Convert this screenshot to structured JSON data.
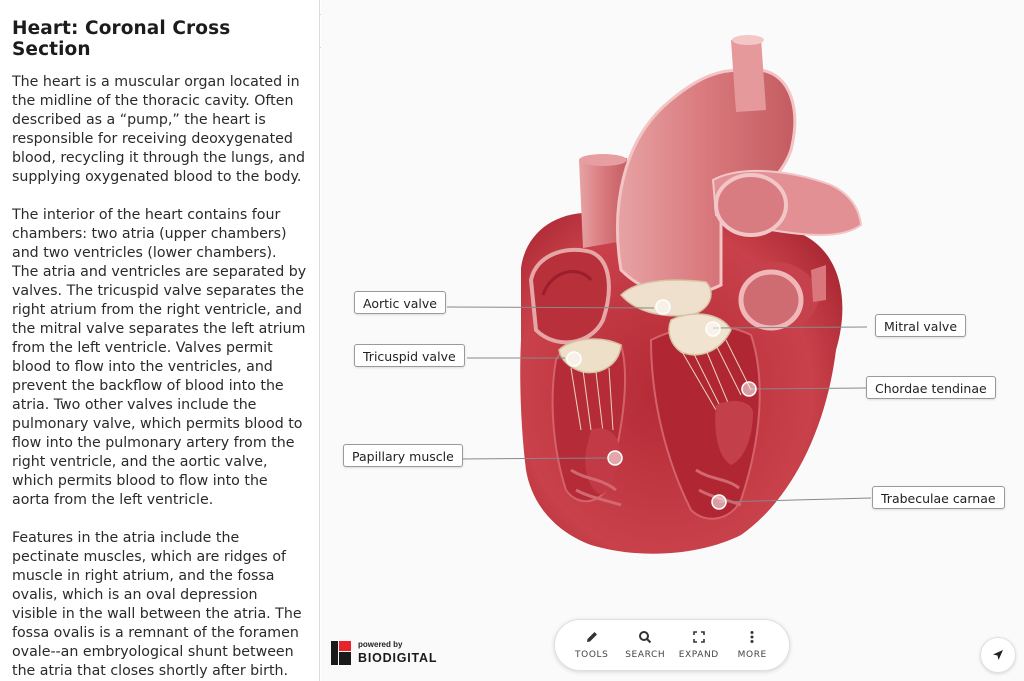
{
  "sidebar": {
    "title": "Heart: Coronal Cross Section",
    "paragraphs": [
      "The heart is a muscular organ located in the midline of the thoracic cavity. Often described as a “pump,” the heart is responsible for receiving deoxygenated blood, recycling it through the lungs, and supplying oxygenated blood to the body.",
      "The interior of the heart contains four chambers: two atria (upper chambers) and two ventricles (lower chambers). The atria and ventricles are separated by valves. The tricuspid valve separates the right atrium from the right ventricle, and the mitral valve separates the left atrium from the left ventricle. Valves permit blood to flow into the ventricles, and prevent the backflow of blood into the atria. Two other valves include the pulmonary valve, which permits blood to flow into the pulmonary artery from the right ventricle, and the aortic valve, which permits blood to flow into the aorta from the left ventricle.",
      "Features in the atria include the pectinate muscles, which are ridges of muscle in right atrium, and the fossa ovalis, which is an oval depression visible in the wall between the atria. The fossa ovalis is a remnant of the foramen ovale--an embryological shunt between the atria that closes shortly after birth."
    ]
  },
  "labels": {
    "aortic_valve": "Aortic valve",
    "tricuspid_valve": "Tricuspid valve",
    "papillary_muscle": "Papillary muscle",
    "mitral_valve": "Mitral valve",
    "chordae_tendinae": "Chordae tendinae",
    "trabeculae_carnae": "Trabeculae carnae"
  },
  "toolbar": {
    "tools": {
      "label": "TOOLS",
      "icon": "pencil-icon"
    },
    "search": {
      "label": "SEARCH",
      "icon": "search-icon"
    },
    "expand": {
      "label": "EXPAND",
      "icon": "expand-icon"
    },
    "more": {
      "label": "MORE",
      "icon": "more-vertical-icon"
    }
  },
  "logo": {
    "powered_by": "powered by",
    "brand": "BIODIGITAL"
  },
  "colors": {
    "muscle": "#c83a44",
    "vessel": "#e0858a",
    "valve": "#efe2cf",
    "accent": "#e8232a"
  }
}
